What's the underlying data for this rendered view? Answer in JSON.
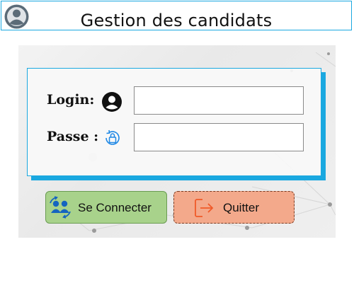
{
  "window": {
    "title": "Gestion des candidats"
  },
  "form": {
    "login_label": "Login:",
    "password_label": "Passe :",
    "login_value": "",
    "password_value": ""
  },
  "buttons": {
    "connect_label": "Se Connecter",
    "quit_label": "Quitter"
  },
  "icons": {
    "avatar": "user-avatar-icon",
    "login": "user-circle-icon",
    "password": "lock-refresh-icon",
    "connect": "users-sync-icon",
    "quit": "exit-arrow-icon"
  },
  "colors": {
    "accent": "#1aa8e0",
    "connect_button": "#a8d28b",
    "quit_button": "#f3a98b",
    "quit_icon": "#f05a28",
    "users_icon": "#1565c0"
  }
}
